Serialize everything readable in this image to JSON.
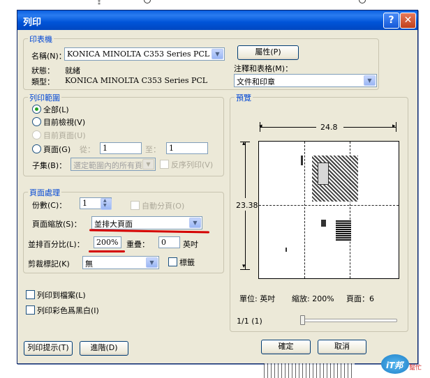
{
  "dialog": {
    "title": "列印",
    "help_glyph": "?",
    "close_glyph": "✕"
  },
  "printer": {
    "group_label": "印表機",
    "name_label": "名稱(N)：",
    "name_value": "KONICA MINOLTA C353 Series PCL",
    "properties_button": "屬性(P)",
    "status_label": "狀態：",
    "status_value": "就緒",
    "type_label": "類型：",
    "type_value": "KONICA MINOLTA C353 Series PCL",
    "comments_label": "注釋和表格(M)：",
    "comments_value": "文件和印章"
  },
  "range": {
    "group_label": "列印範圍",
    "all": "全部(L)",
    "current_view": "目前檢視(V)",
    "current_page": "目前頁面(U)",
    "pages": "頁面(G)",
    "from_label": "從：",
    "from_value": "1",
    "to_label": "至：",
    "to_value": "1",
    "subset_label": "子集(B)：",
    "subset_value": "選定範圍內的所有頁",
    "reverse": "反序列印(V)"
  },
  "handling": {
    "group_label": "頁面處理",
    "copies_label": "份數(C)：",
    "copies_value": "1",
    "collate": "自動分頁(O)",
    "scaling_label": "頁面縮放(S)：",
    "scaling_value": "並排大頁面",
    "tile_scale_label": "並排百分比(L)：",
    "tile_scale_value": "200%",
    "overlap_label": "重疊：",
    "overlap_value": "0",
    "overlap_unit": "英吋",
    "cut_marks_label": "剪裁標記(K)",
    "cut_marks_value": "無",
    "labels_checkbox": "標籤"
  },
  "output": {
    "print_to_file": "列印到檔案(L)",
    "print_color_bw": "列印彩色爲黑白(I)"
  },
  "preview": {
    "group_label": "預覽",
    "width_value": "24.8",
    "height_value": "23.38",
    "units": "單位: 英吋",
    "zoom": "縮放: 200%",
    "pages": "頁面：6",
    "page_index": "1/1 (1)"
  },
  "footer": {
    "tips_button": "列印提示(T)",
    "advanced_button": "進階(D)",
    "ok_button": "確定",
    "cancel_button": "取消"
  },
  "watermark": {
    "logo_text": "iT邦",
    "logo_sub": "幫忙"
  },
  "colors": {
    "title_bar": "#0054d8",
    "group_label": "#0046d5",
    "annotation_red": "#d40000",
    "dialog_bg": "#ece9d8"
  }
}
